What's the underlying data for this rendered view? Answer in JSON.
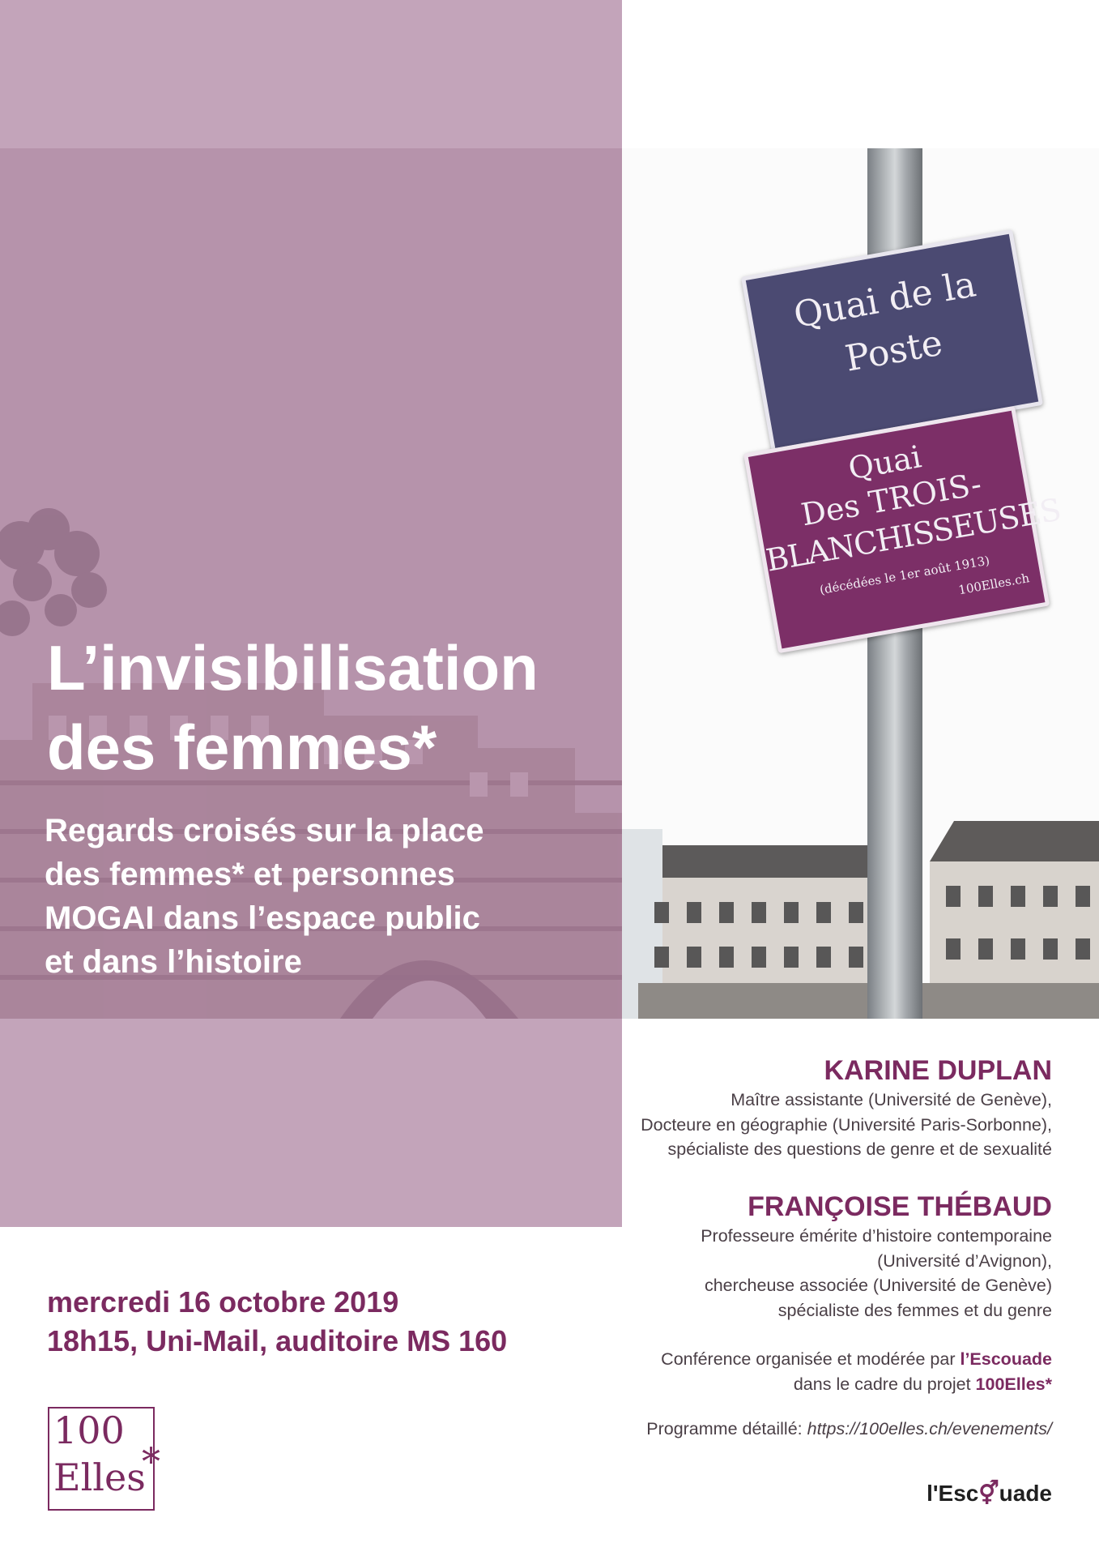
{
  "sign": {
    "blue_line1": "Quai de la",
    "blue_line2": "Poste",
    "purple_line1": "Quai",
    "purple_line2": "Des TROIS-",
    "purple_line3": "BLANCHISSEUSES",
    "purple_line4": "(décédées le 1er août 1913)",
    "purple_line5": "100Elles.ch"
  },
  "title": {
    "line1": "L’invisibilisation",
    "line2": "des femmes*"
  },
  "subtitle": {
    "line1": "Regards croisés sur la place",
    "line2": "des femmes* et personnes",
    "line3": "MOGAI dans l’espace public",
    "line4": "et dans l’histoire"
  },
  "speakers": [
    {
      "name": "KARINE DUPLAN",
      "lines": [
        "Maître assistante (Université de Genève),",
        "Docteure en géographie (Université Paris-Sorbonne),",
        "spécialiste des questions de genre et de sexualité"
      ]
    },
    {
      "name": "FRANÇOISE THÉBAUD",
      "lines": [
        "Professeure émérite d’histoire contemporaine",
        "(Université d’Avignon),",
        "chercheuse associée (Université de Genève)",
        "spécialiste des femmes et du genre"
      ]
    }
  ],
  "event": {
    "date": "mercredi 16 octobre 2019",
    "time_place": "18h15, Uni-Mail, auditoire MS 160"
  },
  "organizer": {
    "prefix": "Conférence organisée et modérée par ",
    "org": "l’Escouade",
    "line2_prefix": "dans le cadre du projet ",
    "project": "100Elles*"
  },
  "program": {
    "label": "Programme détaillé: ",
    "url": "https://100elles.ch/evenements/"
  },
  "logo_100elles": {
    "line1": "100",
    "line2": "Elles",
    "star": "*"
  },
  "logo_escouade": {
    "part1": "l'Esc",
    "symbol": "⚥",
    "part2": "uade"
  },
  "colors": {
    "accent": "#7b2a60",
    "panel_light": "#c3a4ba",
    "panel_photo": "#b693ab"
  }
}
